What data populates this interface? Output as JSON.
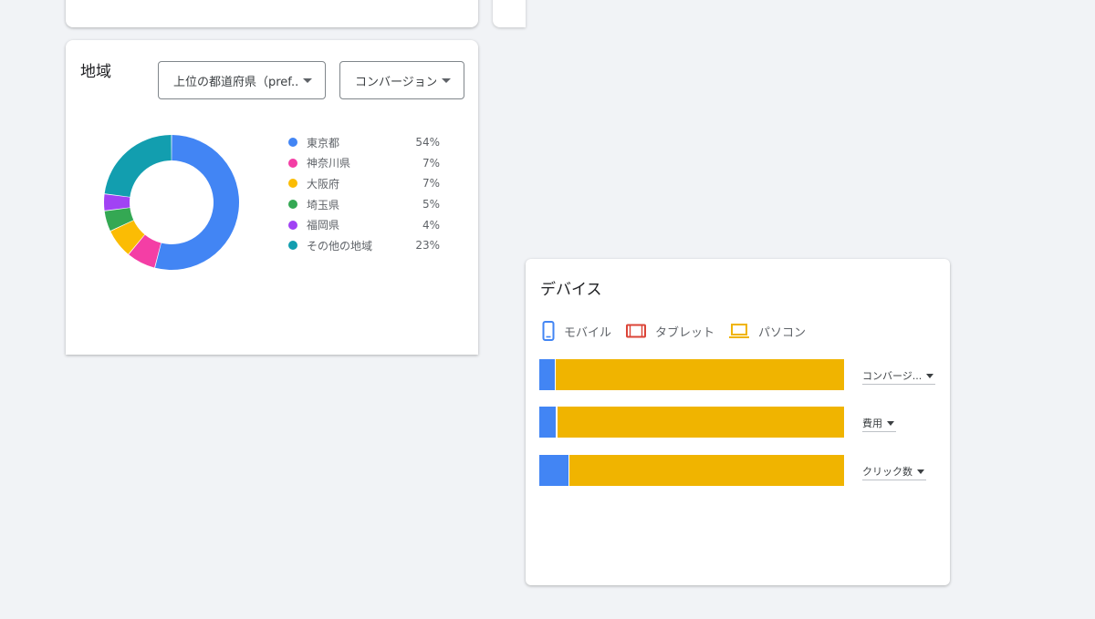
{
  "region": {
    "title": "地域",
    "dropdown_dimension": "上位の都道府県（pref...",
    "dropdown_metric": "コンバージョン",
    "items": [
      {
        "name": "東京都",
        "pct": "54%",
        "value": 54,
        "color": "#4285f4"
      },
      {
        "name": "神奈川県",
        "pct": "7%",
        "value": 7,
        "color": "#f43ea5"
      },
      {
        "name": "大阪府",
        "pct": "7%",
        "value": 7,
        "color": "#fbbc04"
      },
      {
        "name": "埼玉県",
        "pct": "5%",
        "value": 5,
        "color": "#34a853"
      },
      {
        "name": "福岡県",
        "pct": "4%",
        "value": 4,
        "color": "#a142f4"
      },
      {
        "name": "その他の地域",
        "pct": "23%",
        "value": 23,
        "color": "#129eaf"
      }
    ]
  },
  "device": {
    "title": "デバイス",
    "legend": [
      {
        "label": "モバイル",
        "icon": "mobile-icon",
        "color": "#4285f4"
      },
      {
        "label": "タブレット",
        "icon": "tablet-icon",
        "color": "#db4437"
      },
      {
        "label": "パソコン",
        "icon": "laptop-icon",
        "color": "#f0b400"
      }
    ],
    "bars": [
      {
        "metric_label": "コンバージ...",
        "mobile": 5,
        "tablet": 0.5,
        "desktop": 94.5
      },
      {
        "metric_label": "費用",
        "mobile": 5.5,
        "tablet": 0.5,
        "desktop": 94
      },
      {
        "metric_label": "クリック数",
        "mobile": 9.5,
        "tablet": 0.5,
        "desktop": 90
      }
    ]
  },
  "chart_data": [
    {
      "type": "pie",
      "title": "地域",
      "categories": [
        "東京都",
        "神奈川県",
        "大阪府",
        "埼玉県",
        "福岡県",
        "その他の地域"
      ],
      "values": [
        54,
        7,
        7,
        5,
        4,
        23
      ]
    },
    {
      "type": "bar",
      "title": "デバイス",
      "categories": [
        "コンバージ...",
        "費用",
        "クリック数"
      ],
      "series": [
        {
          "name": "モバイル",
          "values": [
            5,
            5.5,
            9.5
          ]
        },
        {
          "name": "タブレット",
          "values": [
            0.5,
            0.5,
            0.5
          ]
        },
        {
          "name": "パソコン",
          "values": [
            94.5,
            94,
            90
          ]
        }
      ]
    }
  ]
}
